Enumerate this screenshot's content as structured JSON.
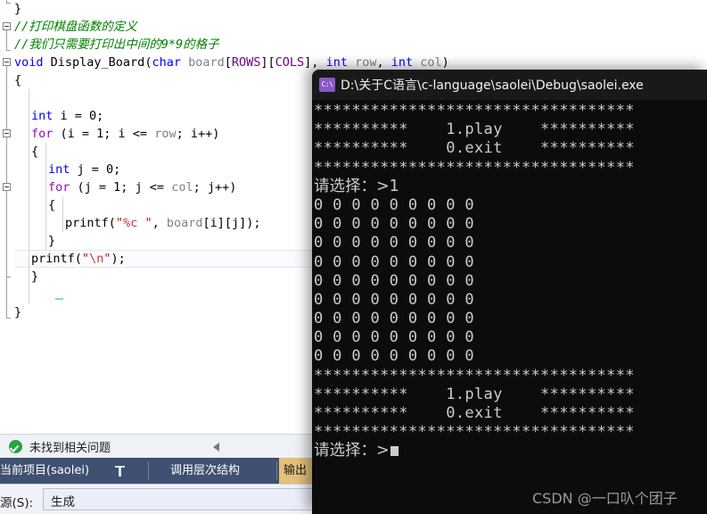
{
  "ide": {
    "editor": {
      "language": "C",
      "lines": [
        {
          "indent": 0,
          "tokens": [
            {
              "t": "}",
              "c": "pun"
            }
          ]
        },
        {
          "indent": 0,
          "tokens": [
            {
              "t": "//打印棋盘函数的定义",
              "c": "com"
            }
          ]
        },
        {
          "indent": 0,
          "tokens": [
            {
              "t": "//我们只需要打印出中间的9*9的格子",
              "c": "com"
            }
          ]
        },
        {
          "indent": 0,
          "tokens": [
            {
              "t": "void ",
              "c": "key"
            },
            {
              "t": "Display_Board",
              "c": "id"
            },
            {
              "t": "(",
              "c": "pun"
            },
            {
              "t": "char ",
              "c": "key"
            },
            {
              "t": "board",
              "c": "gray"
            },
            {
              "t": "[",
              "c": "pun"
            },
            {
              "t": "ROWS",
              "c": "mac"
            },
            {
              "t": "][",
              "c": "pun"
            },
            {
              "t": "COLS",
              "c": "mac"
            },
            {
              "t": "], ",
              "c": "pun"
            },
            {
              "t": "int ",
              "c": "key"
            },
            {
              "t": "row",
              "c": "gray"
            },
            {
              "t": ", ",
              "c": "pun"
            },
            {
              "t": "int ",
              "c": "key"
            },
            {
              "t": "col",
              "c": "gray"
            },
            {
              "t": ")",
              "c": "pun"
            }
          ]
        },
        {
          "indent": 0,
          "tokens": [
            {
              "t": "{",
              "c": "pun"
            }
          ]
        },
        {
          "indent": 0,
          "tokens": []
        },
        {
          "indent": 1,
          "tokens": [
            {
              "t": "int ",
              "c": "key"
            },
            {
              "t": "i = ",
              "c": "id"
            },
            {
              "t": "0;",
              "c": "id"
            }
          ]
        },
        {
          "indent": 1,
          "tokens": [
            {
              "t": "for ",
              "c": "kw2"
            },
            {
              "t": "(i = ",
              "c": "id"
            },
            {
              "t": "1",
              "c": "id"
            },
            {
              "t": "; i <= ",
              "c": "id"
            },
            {
              "t": "row",
              "c": "gray"
            },
            {
              "t": "; i++)",
              "c": "id"
            }
          ]
        },
        {
          "indent": 1,
          "tokens": [
            {
              "t": "{",
              "c": "pun"
            }
          ]
        },
        {
          "indent": 2,
          "tokens": [
            {
              "t": "int ",
              "c": "key"
            },
            {
              "t": "j = ",
              "c": "id"
            },
            {
              "t": "0;",
              "c": "id"
            }
          ]
        },
        {
          "indent": 2,
          "tokens": [
            {
              "t": "for ",
              "c": "kw2"
            },
            {
              "t": "(j = ",
              "c": "id"
            },
            {
              "t": "1",
              "c": "id"
            },
            {
              "t": "; j <= ",
              "c": "id"
            },
            {
              "t": "col",
              "c": "gray"
            },
            {
              "t": "; j++)",
              "c": "id"
            }
          ]
        },
        {
          "indent": 2,
          "tokens": [
            {
              "t": "{",
              "c": "pun"
            }
          ]
        },
        {
          "indent": 3,
          "tokens": [
            {
              "t": "printf",
              "c": "id"
            },
            {
              "t": "(",
              "c": "pun"
            },
            {
              "t": "\"",
              "c": "str"
            },
            {
              "t": "%c",
              "c": "esc"
            },
            {
              "t": " \"",
              "c": "str"
            },
            {
              "t": ", ",
              "c": "pun"
            },
            {
              "t": "board",
              "c": "gray"
            },
            {
              "t": "[i][j]);",
              "c": "id"
            }
          ]
        },
        {
          "indent": 2,
          "tokens": [
            {
              "t": "}",
              "c": "pun"
            }
          ]
        },
        {
          "indent": 1,
          "tokens": [
            {
              "t": "printf",
              "c": "id"
            },
            {
              "t": "(",
              "c": "pun"
            },
            {
              "t": "\"",
              "c": "str"
            },
            {
              "t": "\\n",
              "c": "esc"
            },
            {
              "t": "\"",
              "c": "str"
            },
            {
              "t": ");",
              "c": "pun"
            }
          ]
        },
        {
          "indent": 1,
          "tokens": [
            {
              "t": "}",
              "c": "pun"
            }
          ]
        },
        {
          "indent": 1,
          "tokens": []
        },
        {
          "indent": 0,
          "tokens": [
            {
              "t": "}",
              "c": "pun"
            }
          ]
        }
      ]
    },
    "error_strip": {
      "status_text": "未找到相关问题",
      "status_icon": "check-circle-icon",
      "collapse_icon": "left-arrow-icon"
    },
    "tabs": [
      {
        "label": "当前项目(saolei)",
        "active": false,
        "has_pin": true
      },
      {
        "label": "调用层次结构",
        "active": false,
        "has_pin": false
      },
      {
        "label": "输出",
        "active": true,
        "has_pin": false
      }
    ],
    "source_row": {
      "label": "源(S):",
      "value": "生成"
    }
  },
  "console": {
    "title": "D:\\关于C语言\\c-language\\saolei\\Debug\\saolei.exe",
    "icon": "console-window-icon",
    "icon_text": "C:\\",
    "lines": [
      {
        "text": "**********************************",
        "cjk": false
      },
      {
        "text": "**********    1.play    **********",
        "cjk": false
      },
      {
        "text": "**********    0.exit    **********",
        "cjk": false
      },
      {
        "text": "**********************************",
        "cjk": false
      },
      {
        "text": "请选择：>1",
        "cjk": true
      },
      {
        "text": "0 0 0 0 0 0 0 0 0",
        "cjk": false
      },
      {
        "text": "0 0 0 0 0 0 0 0 0",
        "cjk": false
      },
      {
        "text": "0 0 0 0 0 0 0 0 0",
        "cjk": false
      },
      {
        "text": "0 0 0 0 0 0 0 0 0",
        "cjk": false
      },
      {
        "text": "0 0 0 0 0 0 0 0 0",
        "cjk": false
      },
      {
        "text": "0 0 0 0 0 0 0 0 0",
        "cjk": false
      },
      {
        "text": "0 0 0 0 0 0 0 0 0",
        "cjk": false
      },
      {
        "text": "0 0 0 0 0 0 0 0 0",
        "cjk": false
      },
      {
        "text": "0 0 0 0 0 0 0 0 0",
        "cjk": false
      },
      {
        "text": "**********************************",
        "cjk": false
      },
      {
        "text": "**********    1.play    **********",
        "cjk": false
      },
      {
        "text": "**********    0.exit    **********",
        "cjk": false
      },
      {
        "text": "**********************************",
        "cjk": false
      },
      {
        "text": "请选择：>",
        "cjk": true,
        "cursor": true
      }
    ]
  },
  "watermark": {
    "text": "CSDN @一口叺个团子"
  },
  "colors": {
    "console_bg": "#0c0c0c",
    "console_titlebar": "#191919",
    "console_text": "#cccccc",
    "tabstrip_bg": "#3f5070",
    "active_tab_bg": "#e3c07b",
    "comment_green": "#008000",
    "keyword_blue": "#0000ff",
    "macro_purple": "#6f008a",
    "string_red": "#a31515",
    "ok_green": "#27a343"
  }
}
